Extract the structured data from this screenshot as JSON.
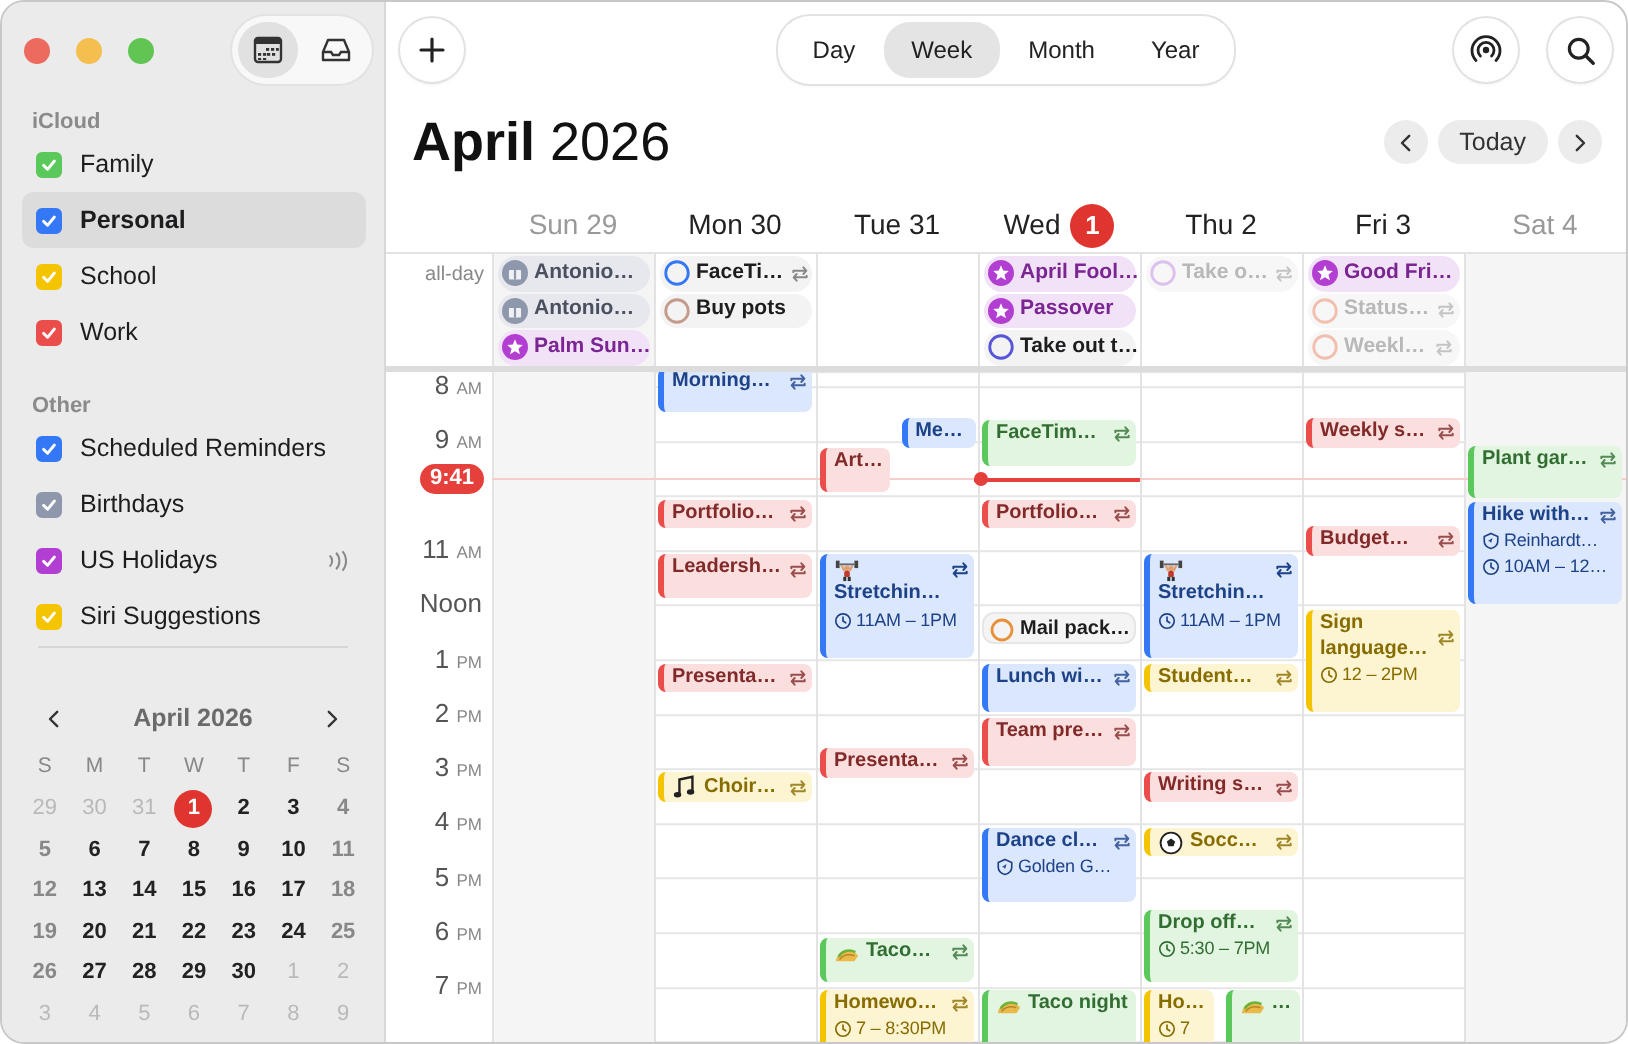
{
  "view_toggle": [
    {
      "selected": true
    },
    {
      "selected": false
    }
  ],
  "sidebar": {
    "groups": [
      {
        "title": "iCloud",
        "items": [
          {
            "label": "Family",
            "color": "#5ac85a",
            "checked": true,
            "selected": false,
            "subscribed": false
          },
          {
            "label": "Personal",
            "color": "#3478f6",
            "checked": true,
            "selected": true,
            "subscribed": false
          },
          {
            "label": "School",
            "color": "#f5c400",
            "checked": true,
            "selected": false,
            "subscribed": false
          },
          {
            "label": "Work",
            "color": "#eb4d4b",
            "checked": true,
            "selected": false,
            "subscribed": false
          }
        ]
      },
      {
        "title": "Other",
        "items": [
          {
            "label": "Scheduled Reminders",
            "color": "#3478f6",
            "checked": true,
            "selected": false,
            "subscribed": false
          },
          {
            "label": "Birthdays",
            "color": "#8e97ab",
            "checked": true,
            "selected": false,
            "subscribed": false
          },
          {
            "label": "US Holidays",
            "color": "#b23fd1",
            "checked": true,
            "selected": false,
            "subscribed": true
          },
          {
            "label": "Siri Suggestions",
            "color": "#f5c400",
            "checked": true,
            "selected": false,
            "subscribed": false
          }
        ]
      }
    ],
    "mini_calendar": {
      "title": "April 2026",
      "weekdays": [
        "S",
        "M",
        "T",
        "W",
        "T",
        "F",
        "S"
      ],
      "weeks": [
        [
          {
            "day": "29",
            "in_month": false,
            "today": false
          },
          {
            "day": "30",
            "in_month": false,
            "today": false
          },
          {
            "day": "31",
            "in_month": false,
            "today": false
          },
          {
            "day": "1",
            "in_month": true,
            "today": true
          },
          {
            "day": "2",
            "in_month": true,
            "today": false
          },
          {
            "day": "3",
            "in_month": true,
            "today": false
          },
          {
            "day": "4",
            "in_month": true,
            "today": false
          }
        ],
        [
          {
            "day": "5",
            "in_month": true,
            "today": false
          },
          {
            "day": "6",
            "in_month": true,
            "today": false
          },
          {
            "day": "7",
            "in_month": true,
            "today": false
          },
          {
            "day": "8",
            "in_month": true,
            "today": false
          },
          {
            "day": "9",
            "in_month": true,
            "today": false
          },
          {
            "day": "10",
            "in_month": true,
            "today": false
          },
          {
            "day": "11",
            "in_month": true,
            "today": false
          }
        ],
        [
          {
            "day": "12",
            "in_month": true,
            "today": false
          },
          {
            "day": "13",
            "in_month": true,
            "today": false
          },
          {
            "day": "14",
            "in_month": true,
            "today": false
          },
          {
            "day": "15",
            "in_month": true,
            "today": false
          },
          {
            "day": "16",
            "in_month": true,
            "today": false
          },
          {
            "day": "17",
            "in_month": true,
            "today": false
          },
          {
            "day": "18",
            "in_month": true,
            "today": false
          }
        ],
        [
          {
            "day": "19",
            "in_month": true,
            "today": false
          },
          {
            "day": "20",
            "in_month": true,
            "today": false
          },
          {
            "day": "21",
            "in_month": true,
            "today": false
          },
          {
            "day": "22",
            "in_month": true,
            "today": false
          },
          {
            "day": "23",
            "in_month": true,
            "today": false
          },
          {
            "day": "24",
            "in_month": true,
            "today": false
          },
          {
            "day": "25",
            "in_month": true,
            "today": false
          }
        ],
        [
          {
            "day": "26",
            "in_month": true,
            "today": false
          },
          {
            "day": "27",
            "in_month": true,
            "today": false
          },
          {
            "day": "28",
            "in_month": true,
            "today": false
          },
          {
            "day": "29",
            "in_month": true,
            "today": false
          },
          {
            "day": "30",
            "in_month": true,
            "today": false
          },
          {
            "day": "1",
            "in_month": false,
            "today": false
          },
          {
            "day": "2",
            "in_month": false,
            "today": false
          }
        ],
        [
          {
            "day": "3",
            "in_month": false,
            "today": false
          },
          {
            "day": "4",
            "in_month": false,
            "today": false
          },
          {
            "day": "5",
            "in_month": false,
            "today": false
          },
          {
            "day": "6",
            "in_month": false,
            "today": false
          },
          {
            "day": "7",
            "in_month": false,
            "today": false
          },
          {
            "day": "8",
            "in_month": false,
            "today": false
          },
          {
            "day": "9",
            "in_month": false,
            "today": false
          }
        ]
      ]
    }
  },
  "views": [
    {
      "label": "Day",
      "selected": false
    },
    {
      "label": "Week",
      "selected": true
    },
    {
      "label": "Month",
      "selected": false
    },
    {
      "label": "Year",
      "selected": false
    }
  ],
  "title": {
    "month": "April",
    "year": "2026"
  },
  "today_button": "Today",
  "all_day_label": "all-day",
  "days": [
    {
      "weekday": "Sun",
      "day": "29",
      "muted": true,
      "today": false,
      "all_day": [
        {
          "kind": "birthday",
          "title": "Antonio…",
          "color": "#8e97ab",
          "faded": false
        },
        {
          "kind": "birthday",
          "title": "Antonio…",
          "color": "#8e97ab",
          "faded": false
        },
        {
          "kind": "holiday",
          "title": "Palm Sun…",
          "color": "#b23fd1",
          "faded": false
        }
      ]
    },
    {
      "weekday": "Mon",
      "day": "30",
      "muted": false,
      "today": false,
      "all_day": [
        {
          "kind": "reminder",
          "title": "FaceTi…",
          "color": "#3478f6",
          "repeats": true,
          "faded": false
        },
        {
          "kind": "reminder",
          "title": "Buy pots",
          "color": "#c49a8a",
          "faded": false
        }
      ],
      "events": [
        {
          "kind": "event",
          "title": "Morning…",
          "color": "#3478f6",
          "repeats": true
        },
        {
          "kind": "event",
          "title": "Portfolio…",
          "color": "#eb4d4b",
          "repeats": true
        },
        {
          "kind": "event",
          "title": "Leadersh…",
          "color": "#eb4d4b",
          "repeats": true
        },
        {
          "kind": "event",
          "title": "Presenta…",
          "color": "#eb4d4b",
          "repeats": true
        },
        {
          "kind": "notes",
          "title": "Choir…",
          "color": "#f5c400",
          "repeats": true
        }
      ]
    },
    {
      "weekday": "Tue",
      "day": "31",
      "muted": false,
      "today": false,
      "events": [
        {
          "kind": "event",
          "title": "Me…",
          "color": "#3478f6"
        },
        {
          "kind": "event",
          "title": "Art…",
          "color": "#eb4d4b"
        },
        {
          "kind": "lifter",
          "title": "Stretchin…",
          "time": "11AM – 1PM",
          "color": "#3478f6",
          "repeats": true
        },
        {
          "kind": "event",
          "title": "Presenta…",
          "color": "#eb4d4b",
          "repeats": true
        },
        {
          "kind": "taco",
          "title": "Taco…",
          "color": "#5ac85a",
          "repeats": true
        },
        {
          "kind": "event",
          "title": "Homewo…",
          "time": "7 – 8:30PM",
          "color": "#f5c400",
          "repeats": true
        }
      ]
    },
    {
      "weekday": "Wed",
      "day": "1",
      "muted": false,
      "today": true,
      "all_day": [
        {
          "kind": "holiday",
          "title": "April Fool…",
          "color": "#b23fd1",
          "faded": false
        },
        {
          "kind": "holiday",
          "title": "Passover",
          "color": "#b23fd1",
          "faded": false
        },
        {
          "kind": "reminder",
          "title": "Take out t…",
          "color": "#5856d6",
          "faded": false
        }
      ],
      "events": [
        {
          "kind": "event",
          "title": "FaceTim…",
          "color": "#5ac85a",
          "repeats": true
        },
        {
          "kind": "event",
          "title": "Portfolio…",
          "color": "#eb4d4b",
          "repeats": true
        },
        {
          "kind": "reminder",
          "title": "Mail pack…",
          "color": "#e8913a"
        },
        {
          "kind": "event",
          "title": "Lunch wi…",
          "color": "#3478f6",
          "repeats": true
        },
        {
          "kind": "event",
          "title": "Team pre…",
          "color": "#eb4d4b",
          "repeats": true
        },
        {
          "kind": "event",
          "title": "Dance cl…",
          "location": "Golden G…",
          "color": "#3478f6",
          "repeats": true
        },
        {
          "kind": "taco",
          "title": "Taco night",
          "color": "#5ac85a"
        }
      ]
    },
    {
      "weekday": "Thu",
      "day": "2",
      "muted": false,
      "today": false,
      "all_day": [
        {
          "kind": "reminder",
          "title": "Take o…",
          "color": "#dcc0ee",
          "repeats": true,
          "faded": true
        }
      ],
      "events": [
        {
          "kind": "lifter",
          "title": "Stretchin…",
          "time": "11AM – 1PM",
          "color": "#3478f6",
          "repeats": true
        },
        {
          "kind": "event",
          "title": "Student…",
          "color": "#f5c400",
          "repeats": true
        },
        {
          "kind": "event",
          "title": "Writing s…",
          "color": "#eb4d4b",
          "repeats": true
        },
        {
          "kind": "ball",
          "title": "Socc…",
          "color": "#f5c400",
          "repeats": true
        },
        {
          "kind": "event",
          "title": "Drop off…",
          "time": "5:30 – 7PM",
          "color": "#5ac85a",
          "repeats": true
        },
        {
          "kind": "event",
          "title": "Ho…",
          "time": "7",
          "color": "#f5c400"
        },
        {
          "kind": "taco",
          "title": "…",
          "color": "#5ac85a"
        }
      ]
    },
    {
      "weekday": "Fri",
      "day": "3",
      "muted": false,
      "today": false,
      "all_day": [
        {
          "kind": "holiday",
          "title": "Good Fri…",
          "color": "#b23fd1",
          "faded": false
        },
        {
          "kind": "reminder",
          "title": "Status…",
          "color": "#f2bfae",
          "repeats": true,
          "faded": true
        },
        {
          "kind": "reminder",
          "title": "Weekl…",
          "color": "#f2bfae",
          "repeats": true,
          "faded": true
        }
      ],
      "events": [
        {
          "kind": "event",
          "title": "Weekly s…",
          "color": "#eb4d4b",
          "repeats": true
        },
        {
          "kind": "event",
          "title": "Budget…",
          "color": "#eb4d4b",
          "repeats": true
        },
        {
          "kind": "event",
          "title": "Sign language…",
          "time": "12 – 2PM",
          "color": "#f5c400",
          "repeats": true
        }
      ]
    },
    {
      "weekday": "Sat",
      "day": "4",
      "muted": true,
      "today": false,
      "events": [
        {
          "kind": "event",
          "title": "Plant gar…",
          "color": "#5ac85a",
          "repeats": true
        },
        {
          "kind": "event",
          "title": "Hike with…",
          "location": "Reinhardt…",
          "time": "10AM – 12…",
          "color": "#3478f6",
          "repeats": true
        }
      ]
    }
  ],
  "hours": [
    {
      "hour": "8",
      "period": "AM"
    },
    {
      "hour": "9",
      "period": "AM"
    },
    {
      "hour": "11",
      "period": "AM"
    },
    {
      "hour": "Noon"
    },
    {
      "hour": "1",
      "period": "PM"
    },
    {
      "hour": "2",
      "period": "PM"
    },
    {
      "hour": "3",
      "period": "PM"
    },
    {
      "hour": "4",
      "period": "PM"
    },
    {
      "hour": "5",
      "period": "PM"
    },
    {
      "hour": "6",
      "period": "PM"
    },
    {
      "hour": "7",
      "period": "PM"
    }
  ],
  "now": {
    "label": "9:41"
  }
}
